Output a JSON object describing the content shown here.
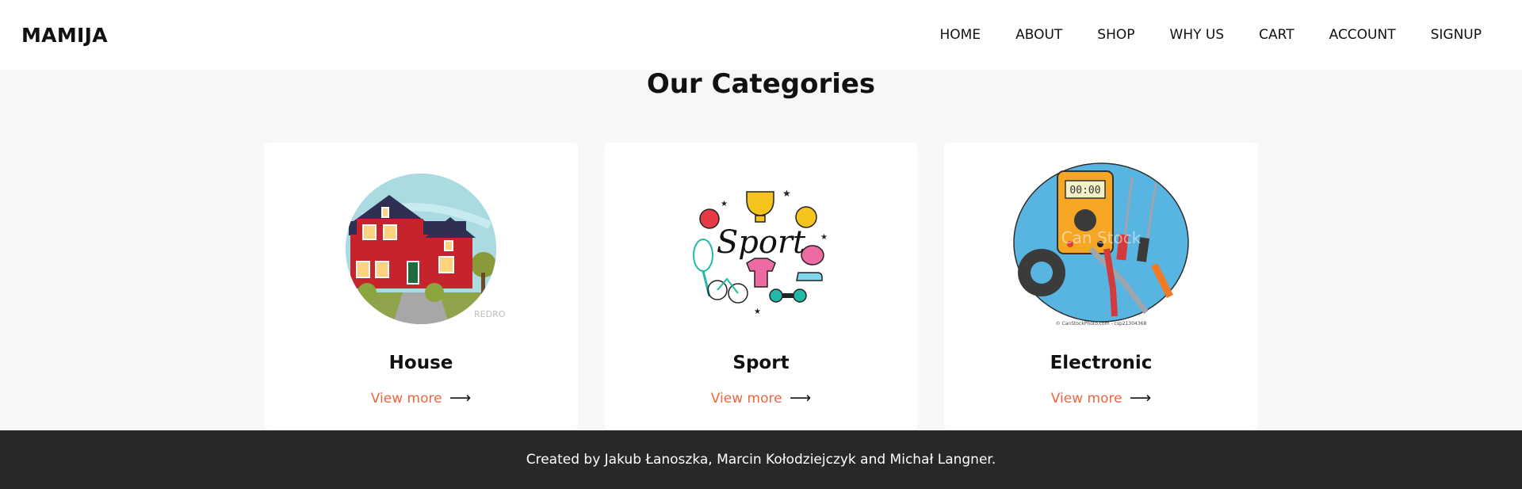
{
  "header": {
    "brand": "MAMIJA",
    "nav": [
      {
        "label": "HOME"
      },
      {
        "label": "ABOUT"
      },
      {
        "label": "SHOP"
      },
      {
        "label": "WHY US"
      },
      {
        "label": "CART"
      },
      {
        "label": "ACCOUNT"
      },
      {
        "label": "SIGNUP"
      }
    ]
  },
  "main": {
    "title": "Our Categories",
    "categories": [
      {
        "name": "House",
        "link_label": "View more",
        "arrow": "⟶",
        "image_icon": "house-illustration",
        "watermark": "REDRO"
      },
      {
        "name": "Sport",
        "link_label": "View more",
        "arrow": "⟶",
        "image_icon": "sport-doodle-illustration"
      },
      {
        "name": "Electronic",
        "link_label": "View more",
        "arrow": "⟶",
        "image_icon": "electronic-tools-illustration",
        "watermark": "Can Stock",
        "caption": "© CanStockPhoto.com - csp21304368"
      }
    ]
  },
  "footer": {
    "credits": "Created by Jakub Łanoszka, Marcin Kołodziejczyk and Michał Langner."
  },
  "colors": {
    "accent": "#f0653e",
    "footer_bg": "#282828",
    "page_bg": "#f7f7f7"
  }
}
